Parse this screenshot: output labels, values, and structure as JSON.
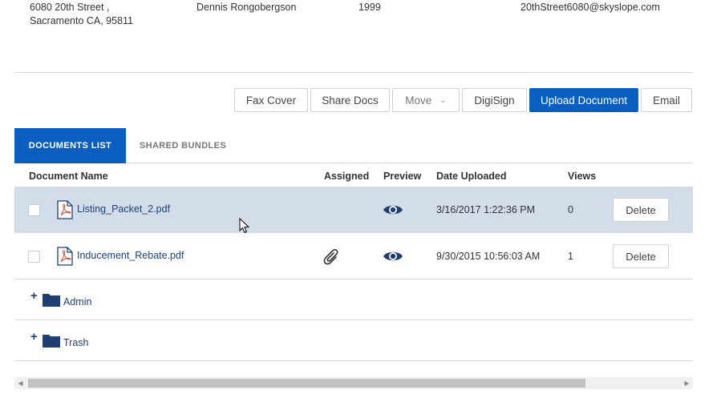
{
  "listing": {
    "address_line1": "6080 20th Street ,",
    "address_line2": "Sacramento CA, 95811",
    "agent": "Dennis Rongobergson",
    "year": "1999",
    "email": "20thStreet6080@skyslope.com"
  },
  "toolbar": {
    "fax_cover": "Fax Cover",
    "share_docs": "Share Docs",
    "move": "Move",
    "digisign": "DigiSign",
    "upload_document": "Upload Document",
    "email": "Email"
  },
  "tabs": {
    "documents_list": "DOCUMENTS LIST",
    "shared_bundles": "SHARED BUNDLES"
  },
  "table": {
    "headers": {
      "document_name": "Document Name",
      "assigned": "Assigned",
      "preview": "Preview",
      "date_uploaded": "Date Uploaded",
      "views": "Views"
    },
    "rows": [
      {
        "name": "Listing_Packet_2.pdf",
        "assigned": false,
        "date": "3/16/2017 1:22:36 PM",
        "views": "0",
        "delete": "Delete",
        "highlighted": true
      },
      {
        "name": "Inducement_Rebate.pdf",
        "assigned": true,
        "date": "9/30/2015 10:56:03 AM",
        "views": "1",
        "delete": "Delete",
        "highlighted": false
      }
    ],
    "folders": [
      {
        "name": "Admin"
      },
      {
        "name": "Trash"
      }
    ]
  },
  "colors": {
    "primary": "#0a5ec0",
    "highlight_row": "#d3dde9",
    "link": "#1f3f73"
  },
  "icons": {
    "file": "pdf-file-icon",
    "assigned": "paperclip-icon",
    "preview": "eye-icon",
    "folder": "folder-icon",
    "expand": "plus-icon"
  }
}
